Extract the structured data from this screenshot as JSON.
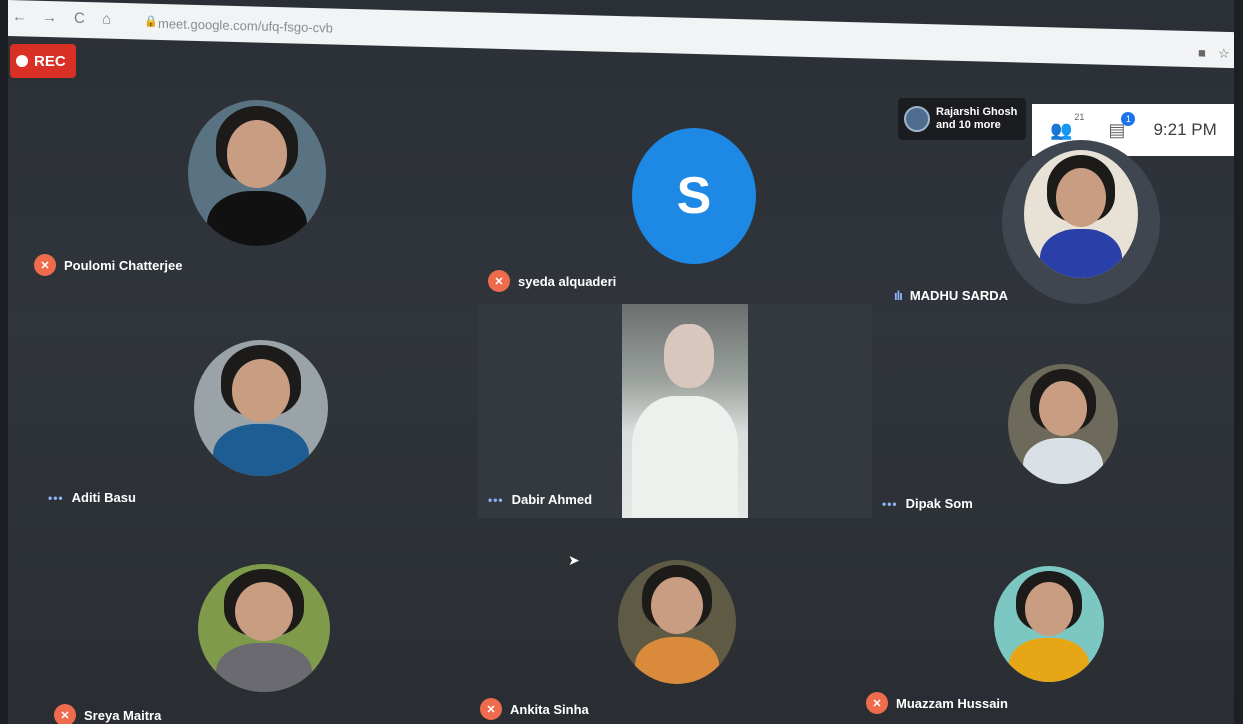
{
  "browser": {
    "back": "←",
    "forward": "→",
    "reload": "C",
    "home": "⌂",
    "url": "meet.google.com/ufq-fsgo-cvb"
  },
  "rec_badge": "REC",
  "presenter": {
    "line1": "Rajarshi Ghosh",
    "line2": "and 10 more"
  },
  "controls": {
    "people_count": "21",
    "chat_badge": "1",
    "time": "9:21 PM"
  },
  "participants": [
    {
      "name": "Poulomi Chatterjee",
      "status": "muted"
    },
    {
      "name": "syeda alquaderi",
      "status": "muted",
      "initial": "S"
    },
    {
      "name": "MADHU SARDA",
      "status": "speaking"
    },
    {
      "name": "Aditi Basu",
      "status": "idle"
    },
    {
      "name": "Dabir Ahmed",
      "status": "idle"
    },
    {
      "name": "Dipak Som",
      "status": "idle"
    },
    {
      "name": "Sreya Maitra",
      "status": "muted"
    },
    {
      "name": "Ankita Sinha",
      "status": "muted"
    },
    {
      "name": "Muazzam Hussain",
      "status": "muted"
    }
  ],
  "colors": {
    "rec": "#d93025",
    "muted": "#ee6c4d",
    "accent": "#1e88e5"
  }
}
